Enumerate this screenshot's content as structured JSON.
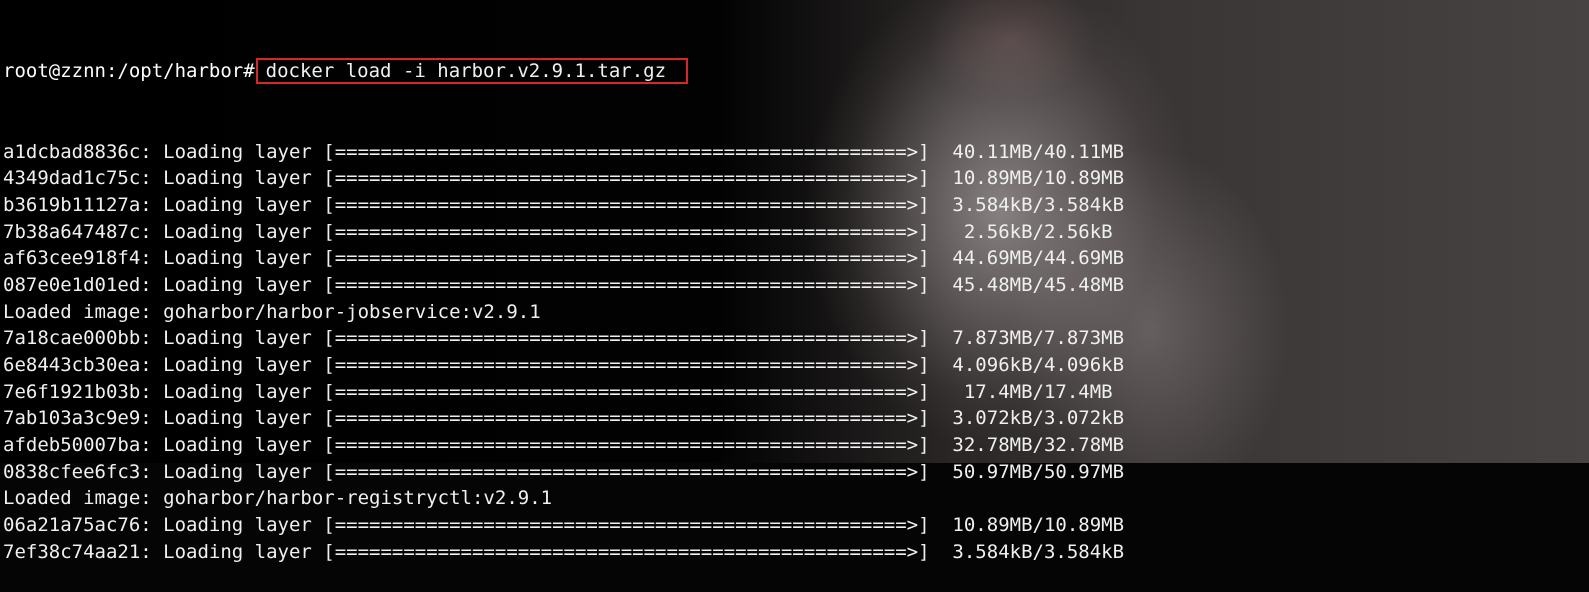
{
  "terminal": {
    "prompt": "root@zznn:/opt/harbor#",
    "command": "docker load -i harbor.v2.9.1.tar.gz",
    "highlight_color": "#d4262c",
    "lines": [
      "a1dcbad8836c: Loading layer [==================================================>]  40.11MB/40.11MB",
      "4349dad1c75c: Loading layer [==================================================>]  10.89MB/10.89MB",
      "b3619b11127a: Loading layer [==================================================>]  3.584kB/3.584kB",
      "7b38a647487c: Loading layer [==================================================>]   2.56kB/2.56kB",
      "af63cee918f4: Loading layer [==================================================>]  44.69MB/44.69MB",
      "087e0e1d01ed: Loading layer [==================================================>]  45.48MB/45.48MB",
      "Loaded image: goharbor/harbor-jobservice:v2.9.1",
      "7a18cae000bb: Loading layer [==================================================>]  7.873MB/7.873MB",
      "6e8443cb30ea: Loading layer [==================================================>]  4.096kB/4.096kB",
      "7e6f1921b03b: Loading layer [==================================================>]   17.4MB/17.4MB",
      "7ab103a3c9e9: Loading layer [==================================================>]  3.072kB/3.072kB",
      "afdeb50007ba: Loading layer [==================================================>]  32.78MB/32.78MB",
      "0838cfee6fc3: Loading layer [==================================================>]  50.97MB/50.97MB",
      "Loaded image: goharbor/harbor-registryctl:v2.9.1",
      "06a21a75ac76: Loading layer [==================================================>]  10.89MB/10.89MB",
      "7ef38c74aa21: Loading layer [==================================================>]  3.584kB/3.584kB"
    ]
  }
}
